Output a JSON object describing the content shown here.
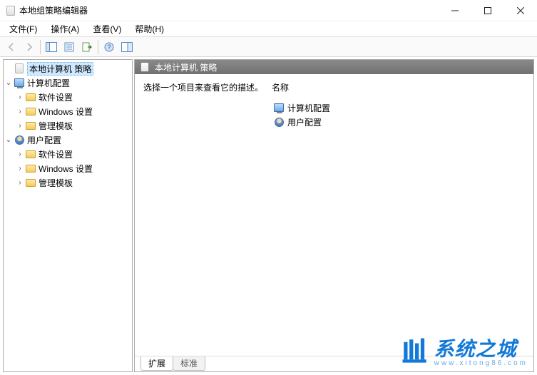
{
  "window": {
    "title": "本地组策略编辑器"
  },
  "menu": {
    "file": "文件(F)",
    "action": "操作(A)",
    "view": "查看(V)",
    "help": "帮助(H)"
  },
  "tree": {
    "root": "本地计算机 策略",
    "computer_config": "计算机配置",
    "software_settings_1": "软件设置",
    "windows_settings_1": "Windows 设置",
    "admin_templates_1": "管理模板",
    "user_config": "用户配置",
    "software_settings_2": "软件设置",
    "windows_settings_2": "Windows 设置",
    "admin_templates_2": "管理模板"
  },
  "pane": {
    "header": "本地计算机 策略",
    "description": "选择一个项目来查看它的描述。",
    "col_name": "名称",
    "item_computer": "计算机配置",
    "item_user": "用户配置"
  },
  "tabs": {
    "extended": "扩展",
    "standard": "标准"
  },
  "watermark": {
    "main": "系统之城",
    "sub": "www.xitong86.com"
  }
}
